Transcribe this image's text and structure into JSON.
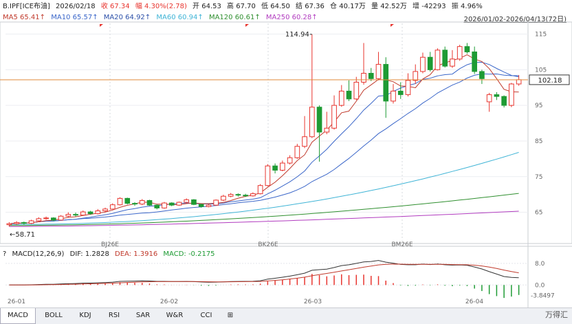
{
  "header": {
    "code": "B.IPF[ICE布油]",
    "date": "2026/02/18",
    "close": "收 67.34",
    "change": "幅 4.30%(2.78)",
    "open": "开 64.53",
    "high": "高 67.70",
    "low": "低 64.50",
    "settle": "结 67.36",
    "position": "仓 40.17万",
    "volume": "量 42.52万",
    "increase": "增 -42293",
    "amplitude": "振 4.96%",
    "range": "2026/01/02-2026/04/13(72日)"
  },
  "ma": {
    "ma5": "MA5 65.41↑",
    "ma10": "MA10 65.57↑",
    "ma20": "MA20 64.92↑",
    "ma60": "MA60 60.94↑",
    "ma120": "MA120 60.61↑",
    "ma250": "MA250 60.28↑"
  },
  "macd": {
    "title": "MACD(12,26,9)",
    "dif": "DIF: 1.2828",
    "dea": "DEA: 1.3916",
    "macd": "MACD: -0.2175",
    "question": "?",
    "latest": "-3.8497"
  },
  "annotations": {
    "high_label": "114.94",
    "low_label": "←58.71",
    "current_price": "102.18"
  },
  "contracts": [
    "BJ26E",
    "BK26E",
    "BM26E"
  ],
  "x_dates": [
    "26-01",
    "26-02",
    "26-03",
    "26-04"
  ],
  "tabs": [
    "MACD",
    "BOLL",
    "KDJ",
    "RSI",
    "SAR",
    "W&R",
    "CCI",
    "⊞"
  ],
  "watermark": "万得汇",
  "colors": {
    "up": "#e8342e",
    "down": "#1e9b34",
    "ma5": "#c0392b",
    "ma10": "#3a66c9",
    "ma20": "#3a66c9",
    "ma60": "#3fb4d6",
    "ma120": "#2f8f2f",
    "ma250": "#b13bbf",
    "price_line": "#e08a3a"
  },
  "chart_data": {
    "type": "candlestick",
    "ylim": [
      57,
      118
    ],
    "yticks": [
      65,
      75,
      85,
      95,
      105,
      115
    ],
    "candles": [
      [
        61.5,
        61.8,
        61.0,
        62.2
      ],
      [
        61.8,
        62.1,
        61.5,
        62.5
      ],
      [
        62.1,
        61.9,
        61.5,
        62.4
      ],
      [
        61.9,
        62.6,
        61.7,
        62.9
      ],
      [
        62.6,
        63.2,
        62.3,
        63.6
      ],
      [
        63.2,
        63.4,
        62.9,
        63.8
      ],
      [
        63.4,
        62.8,
        62.5,
        63.6
      ],
      [
        62.8,
        63.9,
        62.7,
        64.2
      ],
      [
        63.9,
        64.4,
        63.6,
        65.0
      ],
      [
        64.4,
        64.2,
        63.8,
        64.9
      ],
      [
        64.2,
        65.1,
        64.0,
        65.5
      ],
      [
        65.1,
        64.6,
        64.3,
        65.4
      ],
      [
        64.6,
        65.4,
        64.4,
        65.9
      ],
      [
        65.4,
        65.9,
        65.1,
        66.3
      ],
      [
        65.9,
        67.1,
        65.8,
        67.5
      ],
      [
        67.1,
        68.9,
        66.9,
        69.2
      ],
      [
        68.9,
        67.5,
        67.2,
        69.1
      ],
      [
        67.5,
        67.3,
        66.8,
        67.8
      ],
      [
        67.3,
        68.3,
        67.0,
        68.7
      ],
      [
        68.3,
        67.0,
        66.8,
        68.5
      ],
      [
        67.0,
        66.2,
        65.8,
        67.2
      ],
      [
        66.2,
        67.6,
        66.0,
        67.9
      ],
      [
        67.6,
        67.0,
        66.7,
        67.8
      ],
      [
        67.0,
        67.8,
        66.8,
        68.0
      ],
      [
        67.8,
        68.5,
        67.5,
        68.9
      ],
      [
        68.5,
        67.2,
        67.0,
        68.7
      ],
      [
        67.2,
        66.6,
        66.3,
        67.4
      ],
      [
        66.6,
        67.0,
        66.4,
        67.3
      ],
      [
        67.0,
        68.4,
        66.8,
        68.6
      ],
      [
        68.4,
        69.5,
        68.1,
        69.9
      ],
      [
        69.5,
        70.0,
        69.2,
        70.4
      ],
      [
        70.0,
        69.8,
        69.4,
        70.3
      ],
      [
        69.8,
        69.6,
        69.3,
        70.2
      ],
      [
        69.6,
        70.2,
        69.4,
        70.6
      ],
      [
        70.2,
        72.5,
        70.0,
        72.9
      ],
      [
        72.5,
        78.0,
        72.3,
        78.5
      ],
      [
        78.0,
        76.8,
        75.9,
        78.7
      ],
      [
        76.8,
        78.8,
        76.5,
        79.5
      ],
      [
        78.8,
        80.3,
        78.4,
        81.0
      ],
      [
        80.3,
        83.5,
        80.0,
        84.2
      ],
      [
        83.5,
        86.2,
        83.0,
        92.0
      ],
      [
        86.2,
        94.5,
        85.8,
        114.9
      ],
      [
        94.5,
        87.5,
        79.2,
        95.0
      ],
      [
        87.5,
        88.6,
        86.9,
        93.2
      ],
      [
        88.6,
        95.0,
        88.2,
        97.8
      ],
      [
        95.0,
        99.0,
        94.6,
        100.7
      ],
      [
        99.0,
        96.8,
        96.2,
        102.0
      ],
      [
        96.8,
        101.5,
        96.5,
        103.0
      ],
      [
        101.5,
        104.0,
        100.8,
        112.5
      ],
      [
        104.0,
        102.5,
        101.8,
        105.5
      ],
      [
        102.5,
        106.5,
        102.0,
        110.0
      ],
      [
        106.5,
        96.2,
        91.5,
        108.5
      ],
      [
        96.2,
        99.0,
        95.5,
        101.0
      ],
      [
        99.0,
        98.0,
        96.8,
        101.5
      ],
      [
        98.0,
        102.0,
        97.5,
        104.0
      ],
      [
        102.0,
        104.5,
        101.0,
        106.5
      ],
      [
        104.5,
        108.5,
        104.0,
        109.8
      ],
      [
        108.5,
        105.0,
        104.5,
        110.0
      ],
      [
        105.0,
        110.5,
        104.8,
        111.0
      ],
      [
        110.5,
        106.0,
        105.6,
        111.5
      ],
      [
        106.0,
        108.0,
        105.5,
        110.5
      ],
      [
        108.0,
        111.5,
        107.5,
        112.0
      ],
      [
        111.5,
        110.0,
        109.5,
        112.5
      ],
      [
        110.0,
        104.5,
        103.8,
        111.5
      ],
      [
        104.5,
        102.5,
        101.0,
        105.0
      ],
      [
        96.0,
        98.0,
        93.2,
        98.5
      ],
      [
        98.0,
        97.5,
        96.5,
        98.7
      ],
      [
        97.5,
        95.0,
        94.4,
        97.8
      ],
      [
        95.0,
        101.0,
        94.5,
        101.3
      ],
      [
        101.0,
        102.2,
        100.5,
        103.5
      ]
    ],
    "ma5_end": 98.5,
    "ma10_end": 101.0,
    "ma20_end": 102.3,
    "ma60_end": 81.8,
    "ma120_end": 70.3,
    "ma250_end": 65.3,
    "macd_ylim": [
      -4,
      10
    ],
    "macd_yticks": [
      0.0,
      8.0
    ],
    "macd_yticklabels": [
      "0.0",
      "8.0"
    ]
  }
}
